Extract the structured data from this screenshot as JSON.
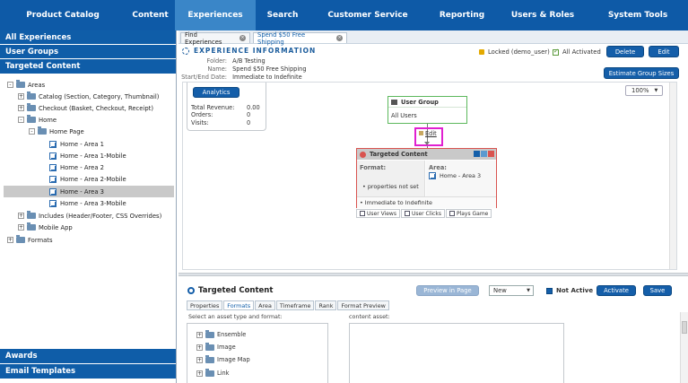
{
  "nav": {
    "items": [
      {
        "label": "Product Catalog",
        "active": false
      },
      {
        "label": "Content",
        "active": false
      },
      {
        "label": "Experiences",
        "active": true
      },
      {
        "label": "Search",
        "active": false
      },
      {
        "label": "Customer Service",
        "active": false
      },
      {
        "label": "Reporting",
        "active": false
      },
      {
        "label": "Users & Roles",
        "active": false
      },
      {
        "label": "System Tools",
        "active": false
      }
    ]
  },
  "sidebar": {
    "headers": [
      "All Experiences",
      "User Groups",
      "Targeted Content"
    ],
    "tree": [
      {
        "label": "Areas",
        "type": "folder",
        "expander": "-"
      },
      {
        "label": "Catalog (Section, Category, Thumbnail)",
        "type": "folder",
        "expander": "+"
      },
      {
        "label": "Checkout (Basket, Checkout, Receipt)",
        "type": "folder",
        "expander": "+"
      },
      {
        "label": "Home",
        "type": "folder",
        "expander": "-"
      },
      {
        "label": "Home Page",
        "type": "folder",
        "expander": "-"
      },
      {
        "label": "Home - Area 1",
        "type": "page"
      },
      {
        "label": "Home - Area 1-Mobile",
        "type": "page"
      },
      {
        "label": "Home - Area 2",
        "type": "page"
      },
      {
        "label": "Home - Area 2-Mobile",
        "type": "page"
      },
      {
        "label": "Home - Area 3",
        "type": "page",
        "selected": true
      },
      {
        "label": "Home - Area 3-Mobile",
        "type": "page"
      },
      {
        "label": "Includes (Header/Footer, CSS Overrides)",
        "type": "folder",
        "expander": "+"
      },
      {
        "label": "Mobile App",
        "type": "folder",
        "expander": "+"
      },
      {
        "label": "Formats",
        "type": "folder",
        "expander": "+"
      }
    ],
    "footer": [
      "Awards",
      "Email Templates"
    ]
  },
  "tabs": [
    {
      "label": "Find Experiences",
      "active": false
    },
    {
      "label": "Spend $50 Free Shipping",
      "active": true
    }
  ],
  "experience": {
    "title": "EXPERIENCE INFORMATION",
    "folder_label": "Folder:",
    "folder_value": "A/B Testing",
    "name_label": "Name:",
    "name_value": "Spend $50 Free Shipping",
    "dates_label": "Start/End Date:",
    "dates_value": "Immediate to Indefinite",
    "locked_text": "Locked (demo_user)",
    "activated_text": "All Activated",
    "delete_label": "Delete",
    "edit_label": "Edit",
    "estimate_label": "Estimate Group Sizes"
  },
  "canvas": {
    "zoom": "100%",
    "analytics_label": "Analytics",
    "stats": [
      {
        "label": "Total Revenue:",
        "value": "0.00"
      },
      {
        "label": "Orders:",
        "value": "0"
      },
      {
        "label": "Visits:",
        "value": "0"
      }
    ],
    "user_group": {
      "title": "User Group",
      "value": "All Users"
    },
    "edit_link": "Edit",
    "targeted": {
      "title": "Targeted Content",
      "format_label": "Format:",
      "format_value": "properties not set",
      "area_label": "Area:",
      "area_value": "Home - Area 3",
      "timeframe": "Immediate to Indefinite",
      "buttons": [
        "User Views",
        "User Clicks",
        "Plays Game"
      ]
    }
  },
  "bottom": {
    "title": "Targeted Content",
    "preview_label": "Preview in Page",
    "status_value": "New",
    "not_active_label": "Not Active",
    "activate_label": "Activate",
    "save_label": "Save",
    "subtabs": [
      {
        "label": "Properties",
        "active": false
      },
      {
        "label": "Formats",
        "active": true
      },
      {
        "label": "Area",
        "active": false
      },
      {
        "label": "Timeframe",
        "active": false
      },
      {
        "label": "Rank",
        "active": false
      },
      {
        "label": "Format Preview",
        "active": false
      }
    ],
    "select_label": "Select an asset type and format:",
    "content_label": "content asset:",
    "assets": [
      "Ensemble",
      "Image",
      "Image Map",
      "Link"
    ]
  }
}
